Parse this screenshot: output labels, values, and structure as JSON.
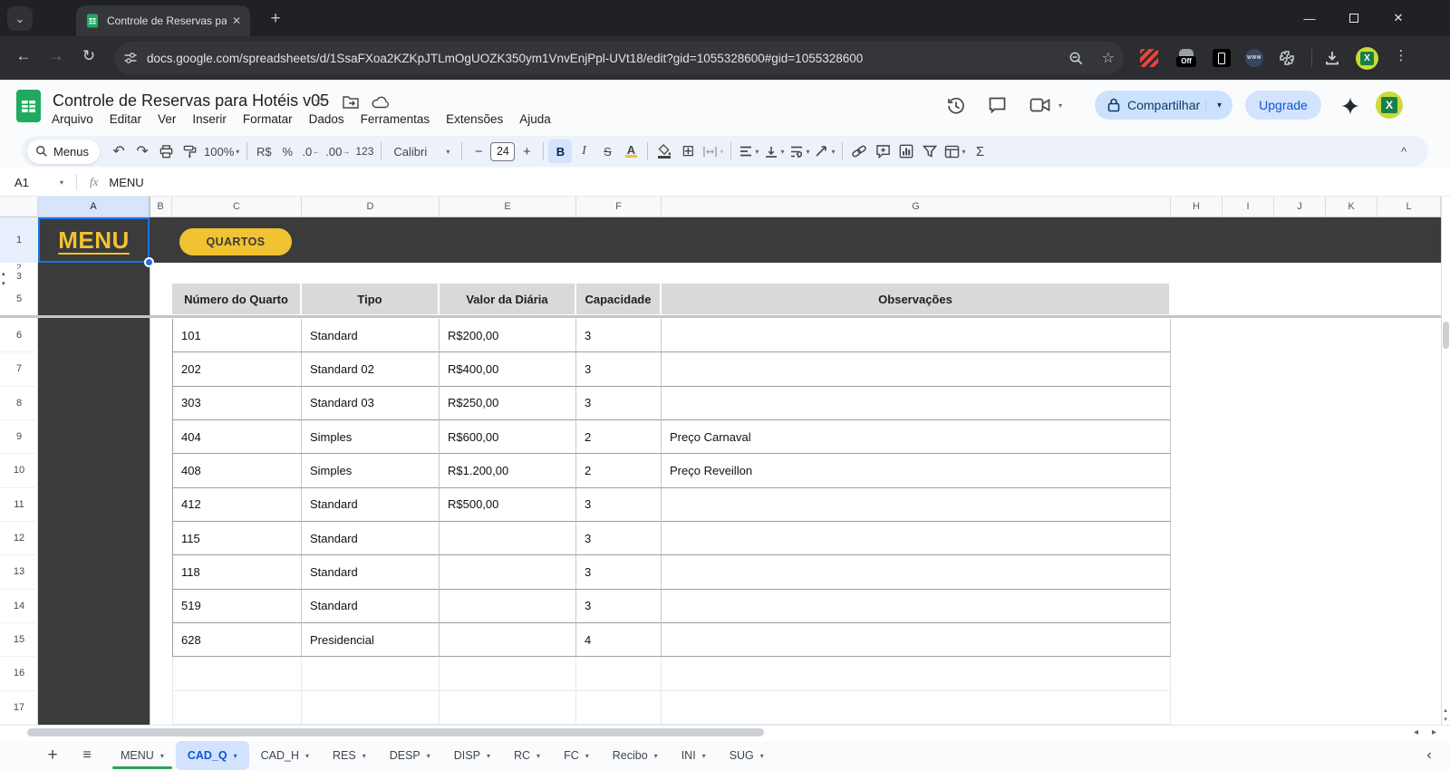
{
  "browser": {
    "tab_title": "Controle de Reservas para Hoté",
    "url": "docs.google.com/spreadsheets/d/1SsaFXoa2KZKpJTLmOgUOZK350ym1VnvEnjPpl-UVt18/edit?gid=1055328600#gid=1055328600"
  },
  "header": {
    "doc_title": "Controle de Reservas para Hotéis v05",
    "menus": [
      "Arquivo",
      "Editar",
      "Ver",
      "Inserir",
      "Formatar",
      "Dados",
      "Ferramentas",
      "Extensões",
      "Ajuda"
    ],
    "share_label": "Compartilhar",
    "upgrade_label": "Upgrade"
  },
  "toolbar": {
    "menus_label": "Menus",
    "zoom": "100%",
    "currency": "R$",
    "percent": "%",
    "dec_decrease": ".0",
    "dec_increase": ".00",
    "more_formats": "123",
    "font": "Calibri",
    "font_size": "24"
  },
  "formula_bar": {
    "cell_ref": "A1",
    "fx": "fx",
    "value": "MENU"
  },
  "grid": {
    "columns": [
      "A",
      "B",
      "C",
      "D",
      "E",
      "F",
      "G",
      "H",
      "I",
      "J",
      "K",
      "L"
    ],
    "row_labels_top": [
      "1",
      "2",
      "3",
      "5"
    ],
    "row_numbers": [
      "6",
      "7",
      "8",
      "9",
      "10",
      "11",
      "12",
      "13",
      "14",
      "15",
      "16",
      "17"
    ],
    "menu_cell": "MENU",
    "quartos_button": "QUARTOS"
  },
  "table": {
    "headers": [
      "Número do Quarto",
      "Tipo",
      "Valor da Diária",
      "Capacidade",
      "Observações"
    ],
    "rows": [
      [
        "101",
        "Standard",
        "R$200,00",
        "3",
        ""
      ],
      [
        "202",
        "Standard 02",
        "R$400,00",
        "3",
        ""
      ],
      [
        "303",
        "Standard 03",
        "R$250,00",
        "3",
        ""
      ],
      [
        "404",
        "Simples",
        "R$600,00",
        "2",
        "Preço Carnaval"
      ],
      [
        "408",
        "Simples",
        "R$1.200,00",
        "2",
        "Preço Reveillon"
      ],
      [
        "412",
        "Standard",
        "R$500,00",
        "3",
        ""
      ],
      [
        "115",
        "Standard",
        "",
        "3",
        ""
      ],
      [
        "118",
        "Standard",
        "",
        "3",
        ""
      ],
      [
        "519",
        "Standard",
        "",
        "3",
        ""
      ],
      [
        "628",
        "Presidencial",
        "",
        "4",
        ""
      ]
    ]
  },
  "sheet_tabs": {
    "tabs": [
      {
        "label": "MENU",
        "color": "#2ba254",
        "active": false
      },
      {
        "label": "CAD_Q",
        "color": "",
        "active": true
      },
      {
        "label": "CAD_H",
        "color": "",
        "active": false
      },
      {
        "label": "RES",
        "color": "",
        "active": false
      },
      {
        "label": "DESP",
        "color": "",
        "active": false
      },
      {
        "label": "DISP",
        "color": "",
        "active": false
      },
      {
        "label": "RC",
        "color": "",
        "active": false
      },
      {
        "label": "FC",
        "color": "",
        "active": false
      },
      {
        "label": "Recibo",
        "color": "",
        "active": false
      },
      {
        "label": "INI",
        "color": "",
        "active": false
      },
      {
        "label": "SUG",
        "color": "",
        "active": false
      }
    ]
  },
  "icons": {
    "tab_search": "⌄",
    "tab_close": "✕",
    "new_tab": "+",
    "win_min": "—",
    "win_close": "✕",
    "back": "←",
    "forward": "→",
    "reload": "↻",
    "star": "☆",
    "menu_dots": "⋮",
    "undo": "↶",
    "redo": "↷",
    "dropdown": "▾",
    "minus": "−",
    "plus": "+",
    "sigma": "Σ",
    "borders": "⊞",
    "bold": "B",
    "italic": "I",
    "strike": "S",
    "color_a": "A",
    "arrow_left": "←",
    "arrow_right": "→",
    "collapse": "^",
    "scroll_left": "◂",
    "scroll_right": "▸",
    "scroll_up": "▴",
    "scroll_down": "▾",
    "tabs_prev": "‹",
    "add_sheet": "+",
    "all_sheets": "≡",
    "hidden_row_up": "▴",
    "hidden_row_down": "▾",
    "off_badge": "Off",
    "ext_circle": "WWW",
    "avatar_x": "X"
  },
  "colors": {
    "accent_yellow": "#f1c232",
    "dark_band": "#3b3b3b",
    "selection_blue": "#1a73e8",
    "active_sheet_tab_bg": "#d3e3fd",
    "active_sheet_tab_text": "#0b57d0",
    "menu_tab_green": "#2ba254",
    "table_header_gray": "#d9d9d9"
  }
}
